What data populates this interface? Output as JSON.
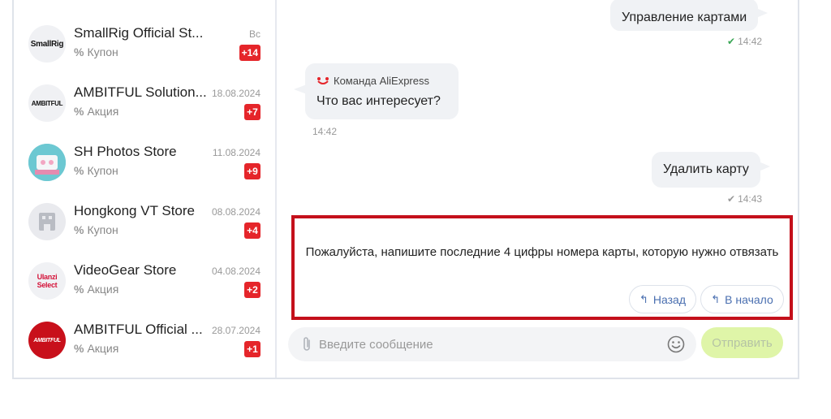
{
  "sidebar": {
    "items": [
      {
        "avatar_text": "",
        "name": "",
        "date": "",
        "type": "Акция",
        "badge": "+2"
      },
      {
        "avatar_text": "SmallRig",
        "name": "SmallRig Official St...",
        "date": "Вс",
        "type": "Купон",
        "badge": "+14"
      },
      {
        "avatar_text": "AMBITFUL",
        "name": "AMBITFUL Solution...",
        "date": "18.08.2024",
        "type": "Акция",
        "badge": "+7"
      },
      {
        "avatar_text": "",
        "name": "SH Photos Store",
        "date": "11.08.2024",
        "type": "Купон",
        "badge": "+9"
      },
      {
        "avatar_text": "",
        "name": "Hongkong VT Store",
        "date": "08.08.2024",
        "type": "Купон",
        "badge": "+4"
      },
      {
        "avatar_text": "Ulanzi Select",
        "name": "VideoGear Store",
        "date": "04.08.2024",
        "type": "Акция",
        "badge": "+2"
      },
      {
        "avatar_text": "AMBITFUL",
        "name": "AMBITFUL Official ...",
        "date": "28.07.2024",
        "type": "Акция",
        "badge": "+1"
      }
    ],
    "percent_symbol": "%"
  },
  "chat": {
    "messages": [
      {
        "text": "Управление картами",
        "time": "14:42",
        "status": "read"
      },
      {
        "sender": "Команда AliExpress",
        "text": "Что вас интересует?",
        "time": "14:42"
      },
      {
        "text": "Удалить карту",
        "time": "14:43",
        "status": "sent"
      }
    ],
    "prompt": {
      "text": "Пожалуйста, напишите последние 4 цифры номера карты, которую нужно отвязать",
      "back_label": "Назад",
      "start_label": "В начало"
    },
    "input": {
      "placeholder": "Введите сообщение"
    },
    "send_label": "Отправить"
  },
  "colors": {
    "badge": "#e5252a",
    "highlight_border": "#c4101b",
    "send_button": "#dff5a8",
    "link": "#4a6fb0"
  }
}
